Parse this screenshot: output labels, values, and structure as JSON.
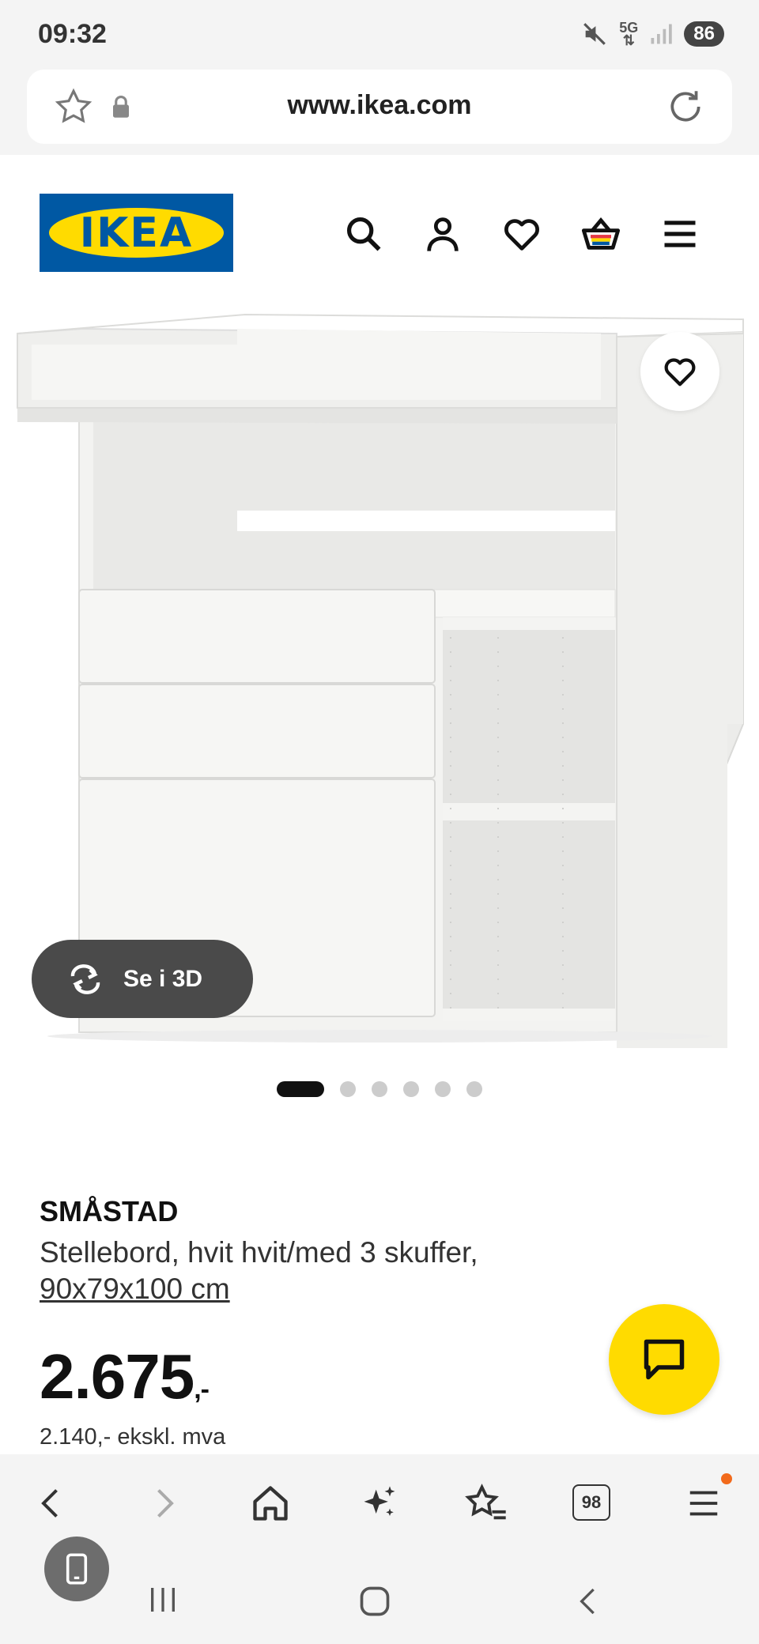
{
  "status_bar": {
    "time": "09:32",
    "network": "5G",
    "battery": "86"
  },
  "browser": {
    "url": "www.ikea.com",
    "tab_count": "98"
  },
  "header": {
    "logo_text": "IKEA",
    "icons": [
      "search-icon",
      "account-icon",
      "wishlist-icon",
      "cart-icon",
      "menu-icon"
    ]
  },
  "gallery": {
    "view_3d_label": "Se i 3D",
    "slide_count": 6,
    "active_slide": 1
  },
  "product": {
    "name": "SMÅSTAD",
    "description": "Stellebord, hvit hvit/med 3 skuffer,",
    "size": "90x79x100 cm",
    "price": "2.675",
    "price_suffix": ",-",
    "price_ex_vat": "2.140,- ekskl. mva"
  },
  "colors": {
    "ikea_blue": "#0058a3",
    "ikea_yellow": "#ffdb00",
    "notification": "#f26a1b"
  }
}
